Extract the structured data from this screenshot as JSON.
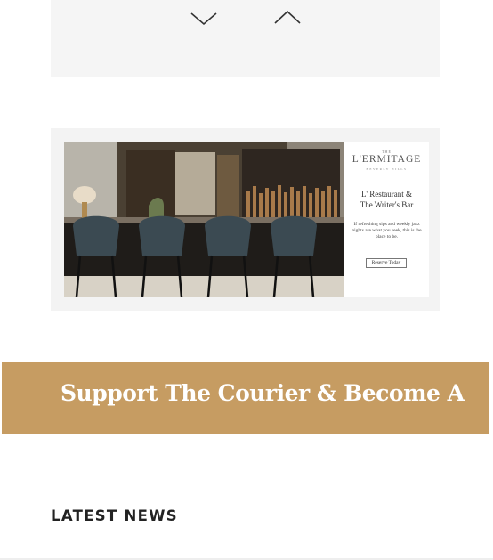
{
  "pager": {
    "down_icon": "chevron-down-icon",
    "up_icon": "chevron-up-icon",
    "icon_color": "#333333"
  },
  "ad": {
    "image_icon": "bar-interior-photo",
    "kicker": "THE",
    "brand": "L'ERMITAGE",
    "brand_sub": "BEVERLY HILLS",
    "heading_line1": "L' Restaurant &",
    "heading_line2": "The Writer's Bar",
    "body": "If refreshing sips and weekly jazz nights are what you seek, this is the place to be.",
    "cta": "Reserve Today"
  },
  "support_banner": {
    "text": "Support The Courier & Become A",
    "color": "#c69c62"
  },
  "latest_news": {
    "heading": "LATEST NEWS"
  }
}
